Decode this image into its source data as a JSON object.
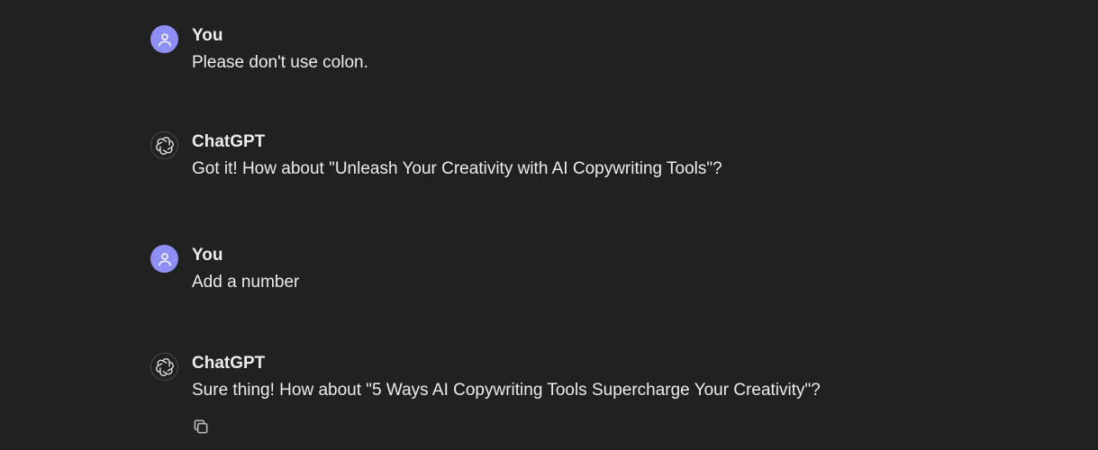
{
  "messages": [
    {
      "role": "user",
      "author": "You",
      "text": "Please don't use colon.",
      "avatar_icon": "user-icon"
    },
    {
      "role": "assistant",
      "author": "ChatGPT",
      "text": "Got it! How about \"Unleash Your Creativity with AI Copywriting Tools\"?",
      "avatar_icon": "openai-logo-icon"
    },
    {
      "role": "user",
      "author": "You",
      "text": "Add a number",
      "avatar_icon": "user-icon"
    },
    {
      "role": "assistant",
      "author": "ChatGPT",
      "text": "Sure thing! How about \"5 Ways AI Copywriting Tools Supercharge Your Creativity\"?",
      "avatar_icon": "openai-logo-icon"
    }
  ],
  "actions": {
    "copy_icon": "copy-icon"
  },
  "colors": {
    "background": "#212121",
    "text": "#ececec",
    "user_avatar": "#8e8ef5"
  }
}
